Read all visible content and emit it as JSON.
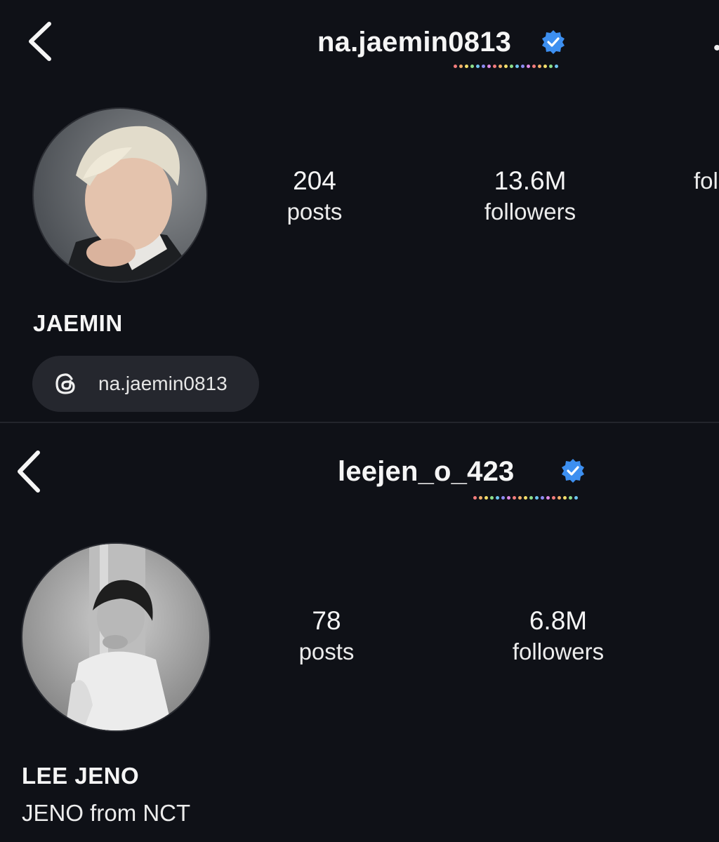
{
  "profiles": [
    {
      "username": "na.jaemin0813",
      "verified": true,
      "display_name": "JAEMIN",
      "bio": "",
      "stats": [
        {
          "value": "204",
          "label": "posts"
        },
        {
          "value": "13.6M",
          "label": "followers"
        },
        {
          "value": "",
          "label": "fol"
        }
      ],
      "threads_handle": "na.jaemin0813"
    },
    {
      "username": "leejen_o_423",
      "verified": true,
      "display_name": "LEE JENO",
      "bio": "JENO from NCT",
      "stats": [
        {
          "value": "78",
          "label": "posts"
        },
        {
          "value": "6.8M",
          "label": "followers"
        }
      ]
    }
  ],
  "colors": {
    "background": "#0f1117",
    "verified_blue": "#3d8ff0",
    "pill": "#25272e",
    "rainbow_dots": [
      "#f27c7c",
      "#f4b06a",
      "#f3de6a",
      "#8ee08a",
      "#6fc5f0",
      "#8e8cf2",
      "#e08be6"
    ]
  },
  "icons": [
    "chevron-left-icon",
    "verified-badge-icon",
    "threads-icon"
  ]
}
